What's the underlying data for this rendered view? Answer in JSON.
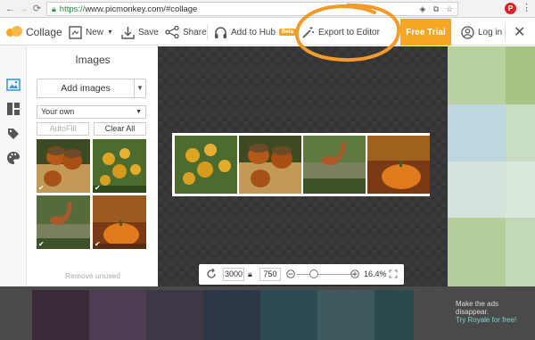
{
  "browser": {
    "url_scheme": "https://",
    "url_rest": "www.picmonkey.com/#collage"
  },
  "toolbar": {
    "brand": "Collage",
    "new_label": "New",
    "save_label": "Save",
    "share_label": "Share",
    "hub_label": "Add to Hub",
    "hub_badge": "Beta",
    "export_label": "Export to Editor",
    "trial_label": "Free Trial",
    "login_label": "Log in"
  },
  "panel": {
    "title": "Images",
    "add_images_label": "Add images",
    "source_select": "Your own",
    "autofill_label": "AutoFill",
    "clear_label": "Clear All",
    "remove_unused_label": "Remove unused"
  },
  "zoom": {
    "width": "3000",
    "height": "750",
    "percent": "16.4%"
  },
  "ad": {
    "line1": "Make the ads",
    "line2": "disappear.",
    "link": "Try Royale for free!"
  },
  "colors": {
    "accent": "#f5a623",
    "canvas": "#3a3a3a",
    "ad_bg": "#4a4a4a",
    "annotation": "#f39a2b"
  }
}
